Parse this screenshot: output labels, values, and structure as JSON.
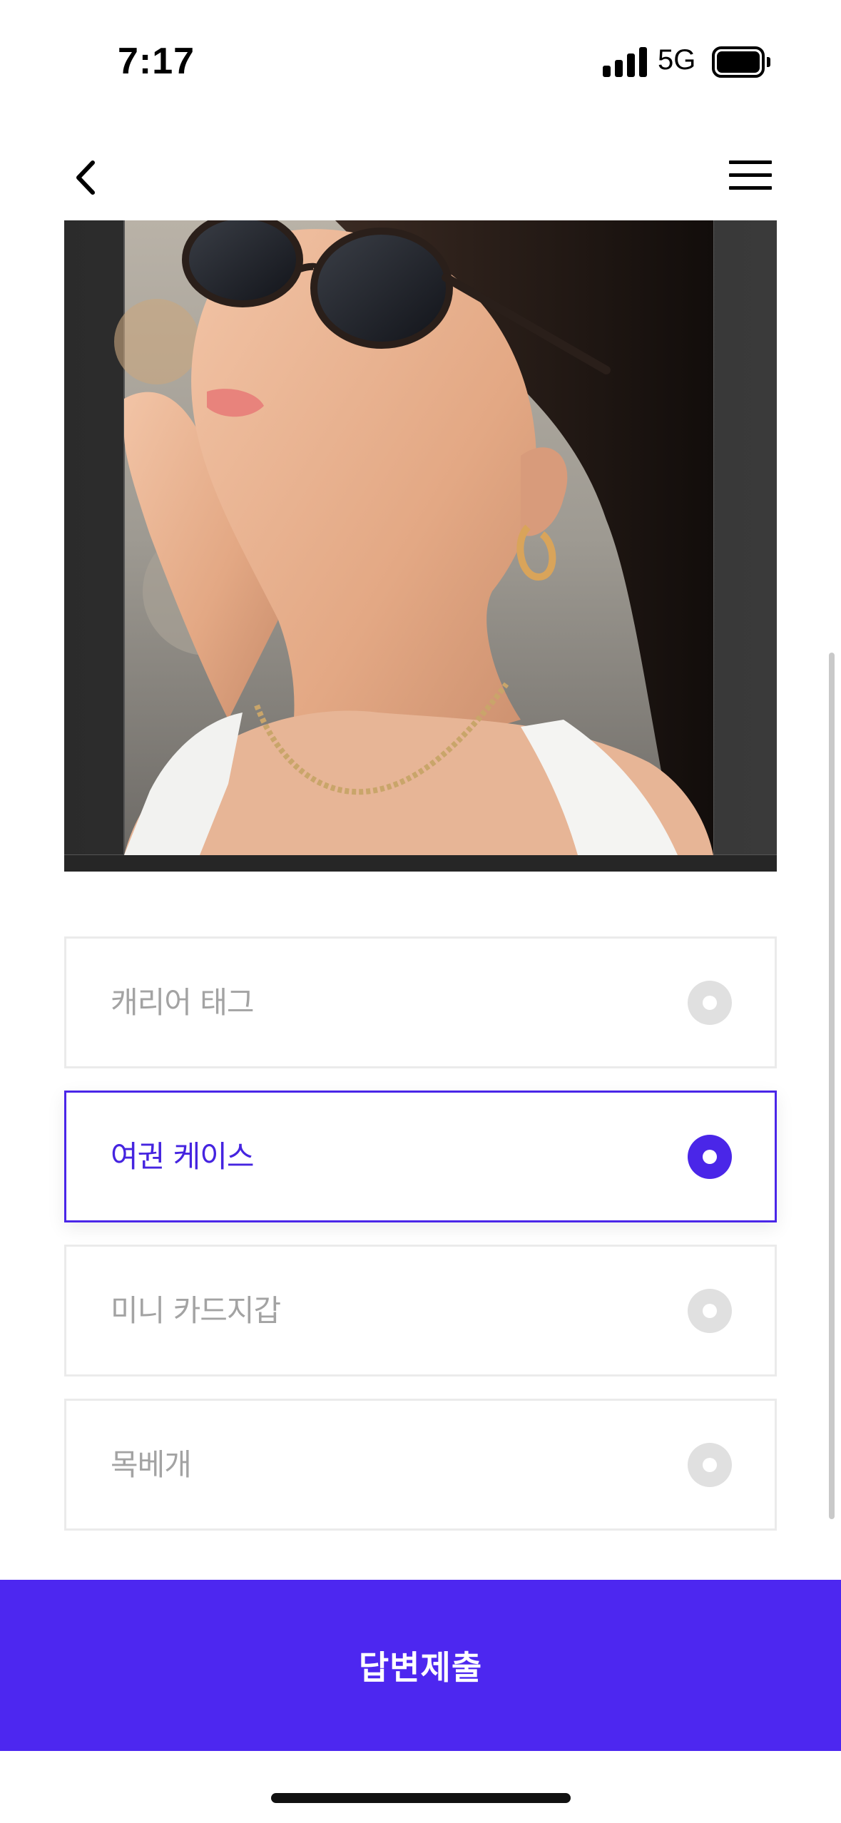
{
  "status_bar": {
    "time": "7:17",
    "network": "5G",
    "icons": [
      "signal-icon",
      "battery-icon"
    ]
  },
  "nav": {
    "back_icon": "chevron-left-icon",
    "menu_icon": "hamburger-menu-icon"
  },
  "photo": {
    "icon": "product-photo-woman-sunglasses"
  },
  "options": [
    {
      "label": "캐리어 태그",
      "selected": false
    },
    {
      "label": "여권 케이스",
      "selected": true
    },
    {
      "label": "미니 카드지갑",
      "selected": false
    },
    {
      "label": "목베개",
      "selected": false
    }
  ],
  "submit": {
    "label": "답변제출"
  },
  "colors": {
    "accent": "#4d27f0",
    "selected_text": "#4524e0",
    "unselected_text": "#a3a3a3",
    "radio_off": "#e0e0e0",
    "border_off": "#ebebeb"
  }
}
